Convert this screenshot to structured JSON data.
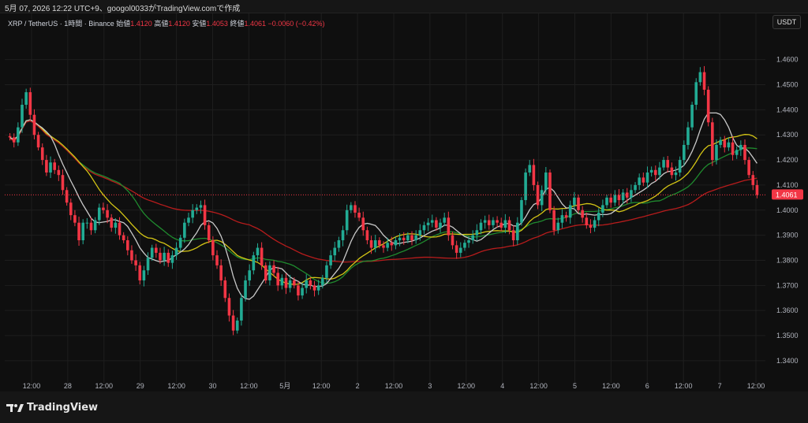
{
  "header": {
    "caption": "5月 07, 2026 12:22 UTC+9、googol0033がTradingView.comで作成"
  },
  "legend": {
    "symbol": "XRP / TetherUS · 1時間 · Binance",
    "open_label": "始値",
    "open_value": "1.4120",
    "high_label": "高値",
    "high_value": "1.4120",
    "low_label": "安値",
    "low_value": "1.4053",
    "close_label": "終値",
    "close_value": "1.4061",
    "change": "−0.0060 (−0.42%)"
  },
  "currency_button": "USDT",
  "brand": {
    "name": "TradingView",
    "logo": "tradingview-logo-icon"
  },
  "colors": {
    "background": "#0f0f0f",
    "up": "#22ab94",
    "down": "#f23645",
    "ma_fast": "#c9c9c9",
    "ma_medium": "#d4c515",
    "ma_slow": "#1f8a2e",
    "ma_long": "#b71c1c"
  },
  "chart_data": {
    "type": "candlestick",
    "title": "XRP / TetherUS · 1時間 · Binance",
    "x_tick_labels": [
      "12:00",
      "28",
      "12:00",
      "29",
      "12:00",
      "30",
      "12:00",
      "5月",
      "12:00",
      "2",
      "12:00",
      "3",
      "12:00",
      "4",
      "12:00",
      "5",
      "12:00",
      "6",
      "12:00",
      "7",
      "12:00"
    ],
    "y_tick_labels": [
      "1.4600",
      "1.4500",
      "1.4400",
      "1.4300",
      "1.4200",
      "1.4100",
      "1.4000",
      "1.3900",
      "1.3800",
      "1.3700",
      "1.3600",
      "1.3500",
      "1.3400"
    ],
    "ylim": [
      1.334,
      1.469
    ],
    "last_price": "1.4061",
    "grid": true,
    "series": [
      {
        "name": "candles",
        "close": [
          1.429,
          1.427,
          1.433,
          1.442,
          1.447,
          1.438,
          1.43,
          1.425,
          1.42,
          1.415,
          1.419,
          1.416,
          1.414,
          1.408,
          1.403,
          1.398,
          1.395,
          1.388,
          1.395,
          1.395,
          1.392,
          1.396,
          1.401,
          1.4,
          1.397,
          1.393,
          1.395,
          1.39,
          1.388,
          1.384,
          1.38,
          1.378,
          1.372,
          1.376,
          1.381,
          1.385,
          1.383,
          1.38,
          1.383,
          1.379,
          1.382,
          1.385,
          1.389,
          1.395,
          1.397,
          1.4,
          1.401,
          1.402,
          1.394,
          1.388,
          1.382,
          1.378,
          1.372,
          1.365,
          1.358,
          1.352,
          1.356,
          1.365,
          1.372,
          1.376,
          1.382,
          1.385,
          1.378,
          1.372,
          1.378,
          1.375,
          1.37,
          1.373,
          1.369,
          1.372,
          1.37,
          1.366,
          1.369,
          1.372,
          1.37,
          1.368,
          1.37,
          1.373,
          1.378,
          1.382,
          1.385,
          1.388,
          1.392,
          1.4,
          1.402,
          1.399,
          1.397,
          1.392,
          1.388,
          1.385,
          1.388,
          1.386,
          1.385,
          1.387,
          1.386,
          1.388,
          1.389,
          1.388,
          1.39,
          1.388,
          1.39,
          1.392,
          1.394,
          1.395,
          1.396,
          1.393,
          1.395,
          1.397,
          1.39,
          1.386,
          1.383,
          1.385,
          1.387,
          1.388,
          1.39,
          1.392,
          1.395,
          1.396,
          1.394,
          1.396,
          1.395,
          1.393,
          1.396,
          1.392,
          1.388,
          1.395,
          1.404,
          1.415,
          1.418,
          1.41,
          1.402,
          1.408,
          1.415,
          1.4,
          1.392,
          1.395,
          1.398,
          1.397,
          1.402,
          1.405,
          1.4,
          1.397,
          1.394,
          1.393,
          1.396,
          1.399,
          1.402,
          1.405,
          1.403,
          1.406,
          1.404,
          1.407,
          1.405,
          1.408,
          1.41,
          1.413,
          1.411,
          1.415,
          1.416,
          1.414,
          1.417,
          1.42,
          1.417,
          1.414,
          1.415,
          1.42,
          1.426,
          1.433,
          1.442,
          1.451,
          1.455,
          1.448,
          1.435,
          1.42,
          1.426,
          1.428,
          1.425,
          1.427,
          1.422,
          1.424,
          1.426,
          1.42,
          1.414,
          1.41,
          1.4061
        ]
      },
      {
        "name": "ma_fast",
        "color": "#c9c9c9",
        "points": [
          [
            0,
            1.427
          ],
          [
            10,
            1.43
          ],
          [
            20,
            1.42
          ],
          [
            40,
            1.4
          ],
          [
            60,
            1.392
          ],
          [
            80,
            1.385
          ],
          [
            100,
            1.378
          ],
          [
            120,
            1.374
          ],
          [
            140,
            1.386
          ],
          [
            160,
            1.396
          ],
          [
            180,
            1.394
          ],
          [
            200,
            1.391
          ],
          [
            220,
            1.391
          ],
          [
            240,
            1.39
          ],
          [
            260,
            1.394
          ],
          [
            280,
            1.392
          ],
          [
            300,
            1.399
          ],
          [
            320,
            1.397
          ],
          [
            340,
            1.394
          ],
          [
            360,
            1.397
          ],
          [
            380,
            1.4
          ],
          [
            400,
            1.402
          ],
          [
            420,
            1.405
          ],
          [
            440,
            1.406
          ],
          [
            460,
            1.406
          ],
          [
            480,
            1.407
          ],
          [
            500,
            1.412
          ],
          [
            520,
            1.42
          ],
          [
            540,
            1.418
          ],
          [
            560,
            1.416
          ]
        ]
      }
    ]
  }
}
